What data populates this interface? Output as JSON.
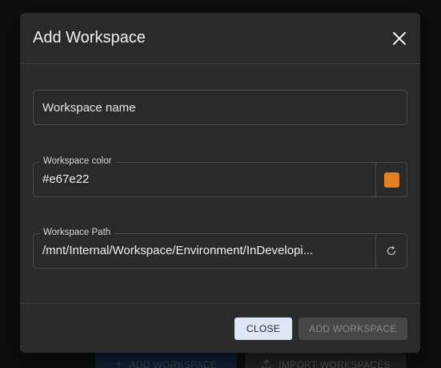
{
  "background": {
    "add_button_label": "ADD WORKSPACE",
    "import_button_label": "IMPORT WORKSPACES"
  },
  "dialog": {
    "title": "Add Workspace",
    "name_field": {
      "placeholder": "Workspace name",
      "value": ""
    },
    "color_field": {
      "label": "Workspace color",
      "value": "#e67e22",
      "swatch_color": "#e67e22"
    },
    "path_field": {
      "label": "Workspace Path",
      "value": "/mnt/Internal/Workspace/Environment/InDevelopi..."
    },
    "close_label": "CLOSE",
    "add_label": "ADD WORKSPACE"
  },
  "icons": {
    "close": "close-icon",
    "plus": "plus-icon",
    "upload": "upload-icon",
    "reset": "reset-path-icon"
  },
  "colors": {
    "dialog_bg": "#2a2a2a",
    "close_button_bg": "#dde6f5",
    "add_button_disabled_bg": "#474747"
  }
}
